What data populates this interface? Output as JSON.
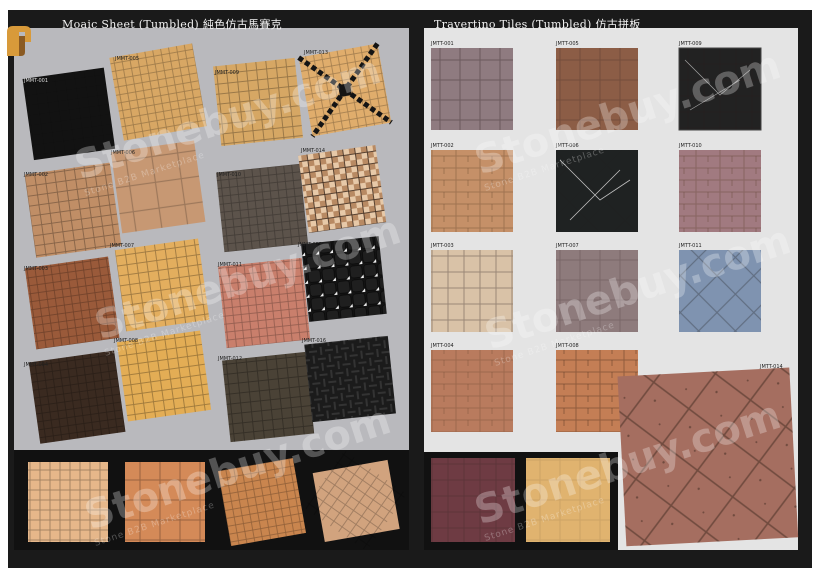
{
  "left_page": {
    "title": "Moaic Sheet  (Tumbled) 純色仿古馬賽克",
    "codes": [
      "JMMT-001",
      "JMMT-005",
      "JMMT-009",
      "JMMT-013",
      "JMMT-002",
      "JMMT-006",
      "JMMT-010",
      "JMMT-014",
      "JMMT-003",
      "JMMT-007",
      "JMMT-011",
      "JMMT-015",
      "JMMT-004",
      "JMMT-008",
      "JMMT-012",
      "JMMT-016"
    ]
  },
  "right_page": {
    "title": "Travertino Tiles (Tumbled) 仿古拼板",
    "codes": [
      "JMTT-001",
      "JMTT-005",
      "JMTT-009",
      "JMTT-002",
      "JMTT-006",
      "JMTT-010",
      "JMTT-003",
      "JMTT-007",
      "JMTT-011",
      "JMTT-004",
      "JMTT-008",
      "JMTT-014"
    ]
  },
  "watermark": {
    "brand": "Stonebuy.com",
    "tagline": "Stone B2B Marketplace"
  },
  "colors": {
    "black": "#151515",
    "sand": "#d7a66a",
    "tan": "#c49468",
    "orange": "#e1ac5c",
    "rust": "#9a5a3a",
    "gray_dark": "#5b534a",
    "pink": "#c97f6c",
    "brown_dark": "#3a2a20",
    "mauve": "#8f7b80",
    "walnut": "#8c5d46",
    "marble_black": "#1f2222",
    "cream": "#d9c2a7",
    "rose": "#a17a80",
    "slate": "#7f93b0",
    "terra": "#b97b5e",
    "copper": "#c47e55",
    "wine": "#6e3b43"
  }
}
